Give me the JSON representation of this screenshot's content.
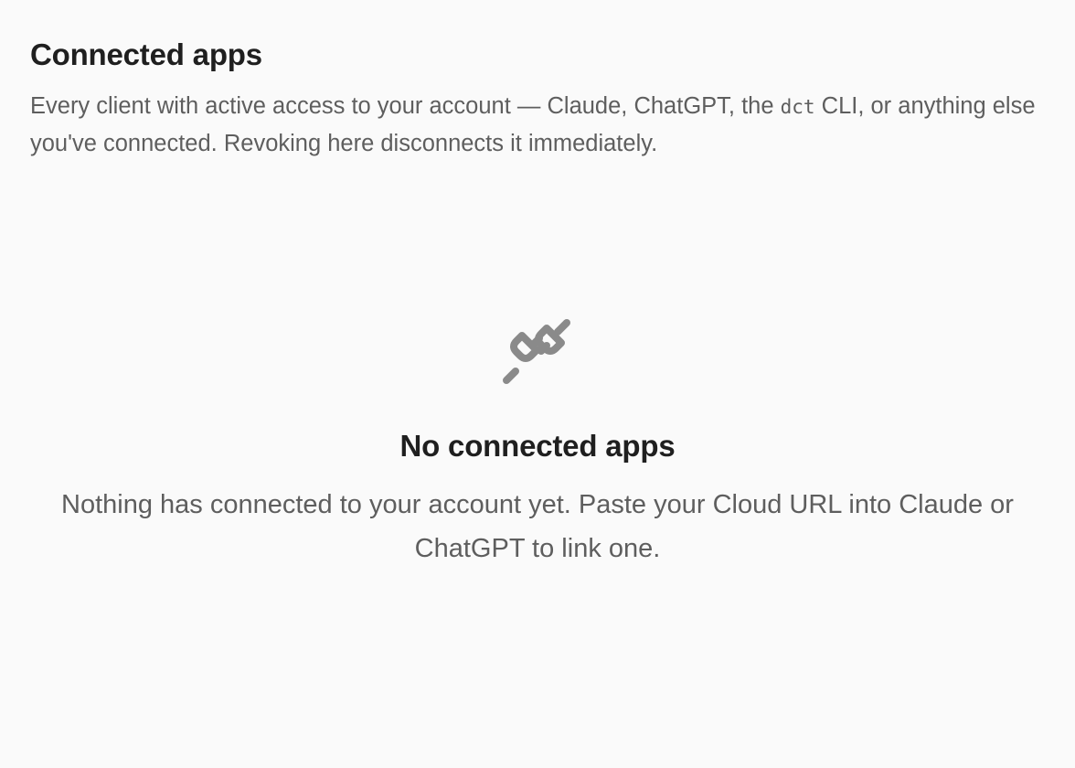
{
  "connected_apps": {
    "title": "Connected apps",
    "description_before_code": "Every client with active access to your account — Claude, ChatGPT, the ",
    "description_code": "dct",
    "description_after_code": " CLI, or anything else you've connected. Revoking here disconnects it immediately."
  },
  "empty_state": {
    "icon": "plug-disconnected-icon",
    "title": "No connected apps",
    "description": "Nothing has connected to your account yet. Paste your Cloud URL into Claude or ChatGPT to link one."
  },
  "colors": {
    "background": "#fafafa",
    "heading": "#1f1f1f",
    "body_text": "#5e5e5e",
    "icon": "#8a8a8a"
  }
}
